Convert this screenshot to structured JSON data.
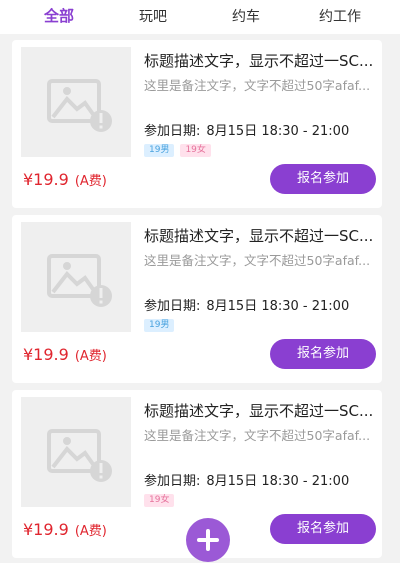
{
  "tabs": [
    {
      "label": "全部",
      "active": true
    },
    {
      "label": "玩吧",
      "active": false
    },
    {
      "label": "约车",
      "active": false
    },
    {
      "label": "约工作",
      "active": false
    }
  ],
  "colors": {
    "accent": "#8a3fd1",
    "price": "#e0262f"
  },
  "cards": [
    {
      "title": "标题描述文字，显示不超过一SC...",
      "note": "这里是备注文字，文字不超过50字afaf...",
      "date_label": "参加日期:",
      "date_value": "8月15日 18:30 - 21:00",
      "tags": [
        {
          "text": "19男",
          "kind": "male"
        },
        {
          "text": "19女",
          "kind": "female"
        }
      ],
      "price": "¥19.9",
      "fee": "(A费)",
      "button": "报名参加",
      "image_icon": "image-placeholder-icon"
    },
    {
      "title": "标题描述文字，显示不超过一SC...",
      "note": "这里是备注文字，文字不超过50字afaf...",
      "date_label": "参加日期:",
      "date_value": "8月15日 18:30 - 21:00",
      "tags": [
        {
          "text": "19男",
          "kind": "male"
        }
      ],
      "price": "¥19.9",
      "fee": "(A费)",
      "button": "报名参加",
      "image_icon": "image-placeholder-icon"
    },
    {
      "title": "标题描述文字，显示不超过一SC...",
      "note": "这里是备注文字，文字不超过50字afaf...",
      "date_label": "参加日期:",
      "date_value": "8月15日 18:30 - 21:00",
      "tags": [
        {
          "text": "19女",
          "kind": "female"
        }
      ],
      "price": "¥19.9",
      "fee": "(A费)",
      "button": "报名参加",
      "image_icon": "image-placeholder-icon"
    }
  ],
  "fab": {
    "icon": "plus-icon"
  }
}
